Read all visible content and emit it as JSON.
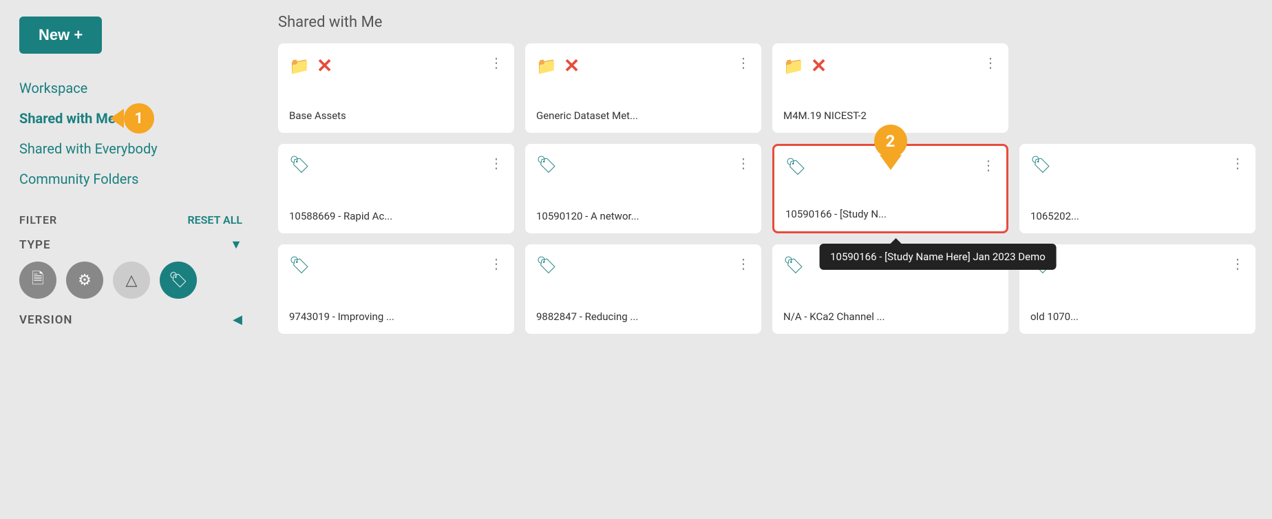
{
  "sidebar": {
    "new_button": "New +",
    "nav_items": [
      {
        "id": "workspace",
        "label": "Workspace",
        "active": false
      },
      {
        "id": "shared-with-me",
        "label": "Shared with Me",
        "active": true
      },
      {
        "id": "shared-with-everybody",
        "label": "Shared with Everybody",
        "active": false
      },
      {
        "id": "community-folders",
        "label": "Community Folders",
        "active": false
      }
    ],
    "badge_1": "1",
    "filter": {
      "label": "FILTER",
      "reset_label": "RESET ALL",
      "type_label": "TYPE",
      "version_label": "VERSION"
    }
  },
  "main": {
    "title": "Shared with Me",
    "rows": [
      {
        "cards": [
          {
            "id": "base-assets",
            "icon": "folder",
            "has_x": true,
            "label": "Base Assets"
          },
          {
            "id": "generic-dataset",
            "icon": "folder",
            "has_x": true,
            "label": "Generic Dataset Met..."
          },
          {
            "id": "m4m",
            "icon": "folder",
            "has_x": true,
            "label": "M4M.19 NICEST-2"
          },
          null
        ]
      },
      {
        "cards": [
          {
            "id": "10588669",
            "icon": "tag",
            "has_x": false,
            "label": "10588669 - Rapid Ac..."
          },
          {
            "id": "10590120",
            "icon": "tag",
            "has_x": false,
            "label": "10590120 - A networ..."
          },
          {
            "id": "10590166",
            "icon": "tag",
            "has_x": false,
            "label": "10590166 - [Study N...",
            "highlighted": true,
            "tooltip": "10590166 - [Study Name Here] Jan 2023 Demo",
            "badge_2": "2"
          },
          {
            "id": "10652027",
            "icon": "tag",
            "has_x": false,
            "label": "1065202..."
          }
        ]
      },
      {
        "cards": [
          {
            "id": "9743019",
            "icon": "tag",
            "has_x": false,
            "label": "9743019 - Improving ..."
          },
          {
            "id": "9882847",
            "icon": "tag",
            "has_x": false,
            "label": "9882847 - Reducing ..."
          },
          {
            "id": "na-kca2",
            "icon": "tag",
            "has_x": false,
            "label": "N/A - KCa2 Channel ..."
          },
          {
            "id": "old-10701",
            "icon": "tag",
            "has_x": false,
            "label": "old 1070..."
          }
        ]
      }
    ]
  }
}
